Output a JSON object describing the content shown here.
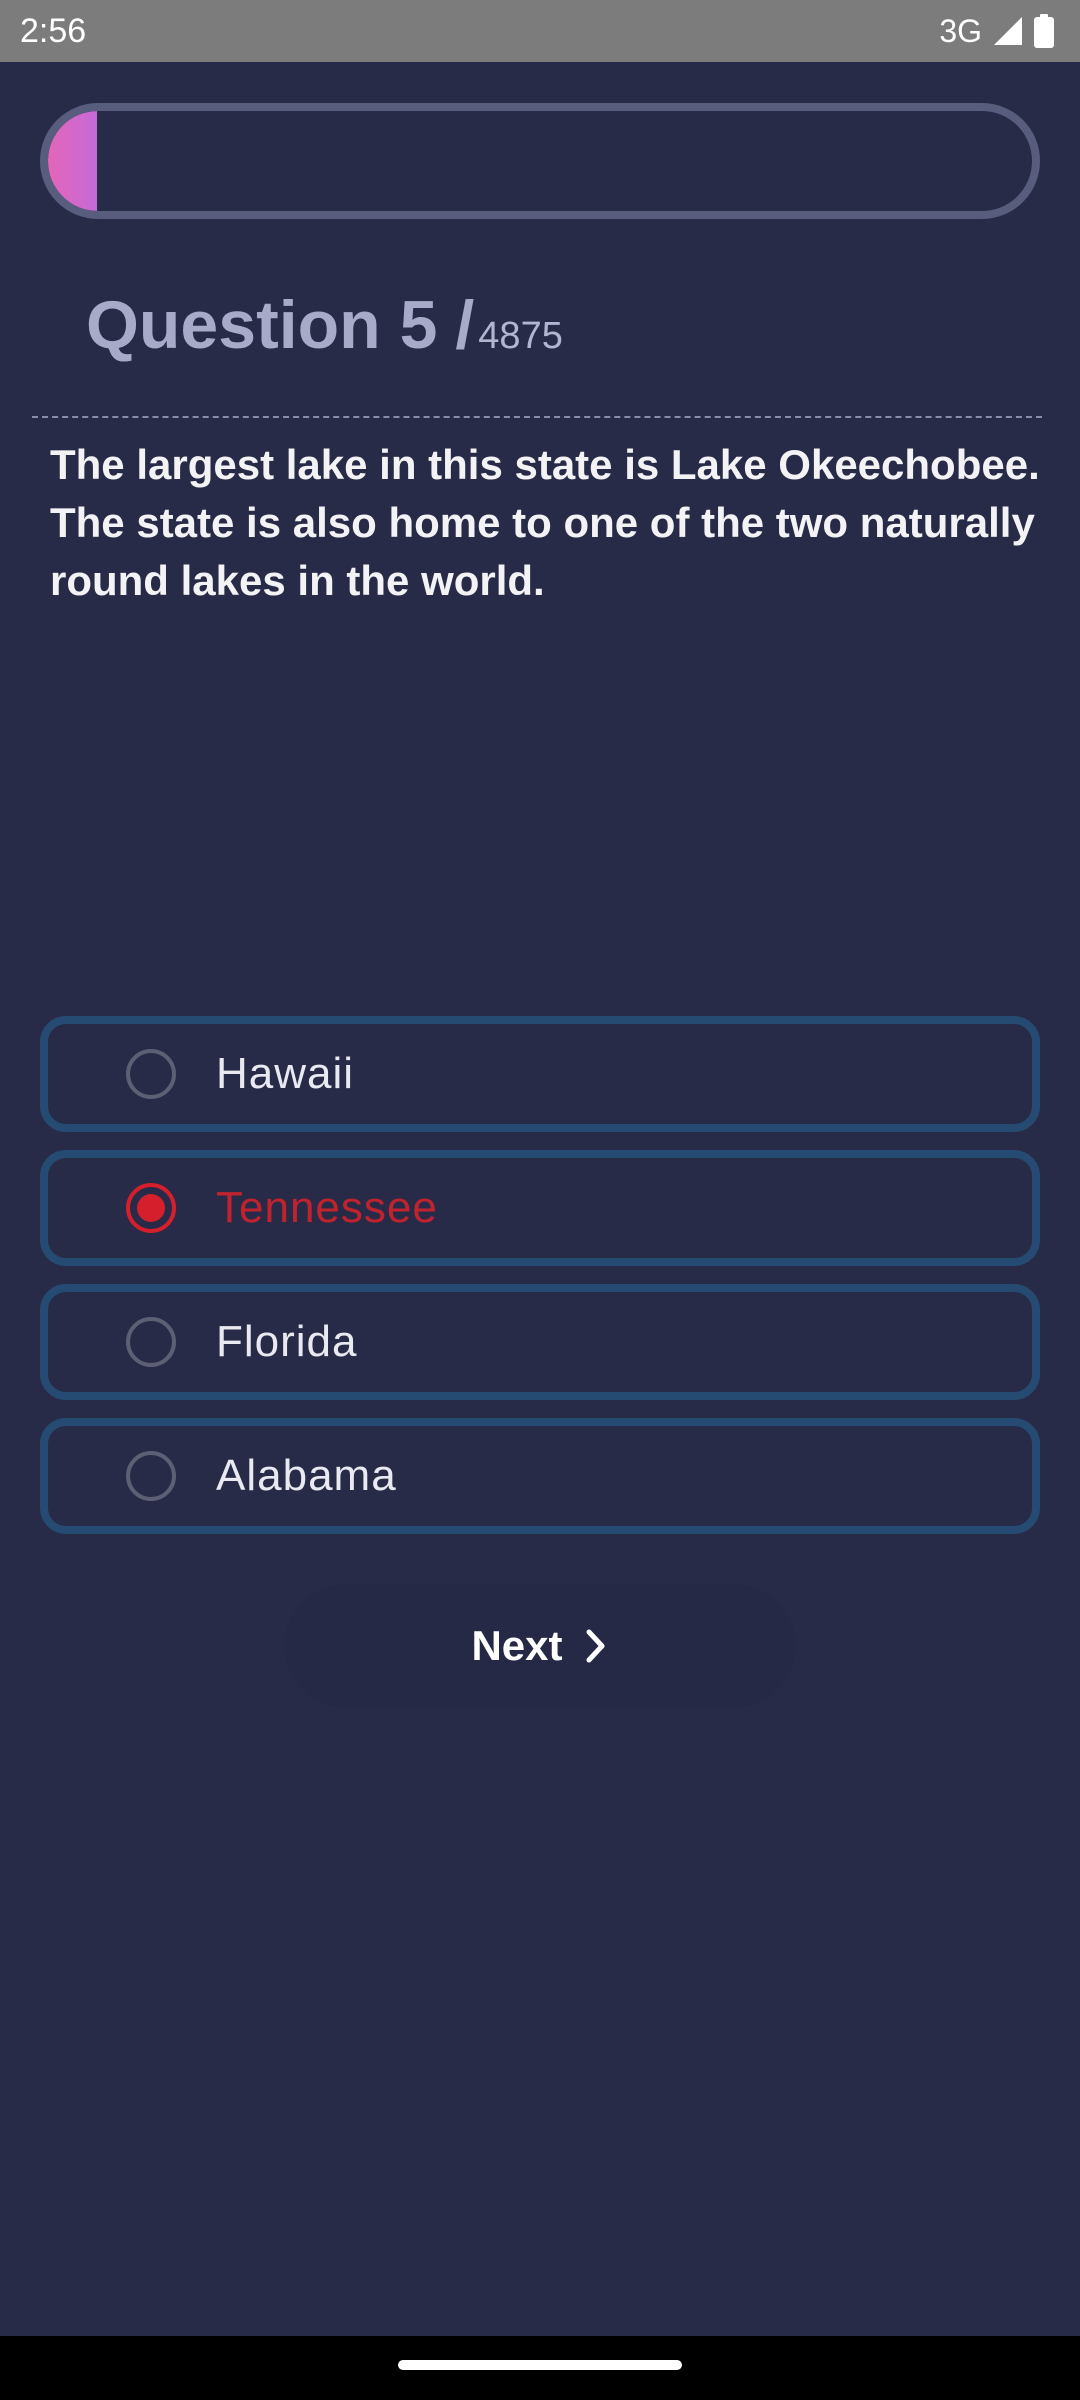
{
  "status_bar": {
    "time": "2:56",
    "network": "3G",
    "signal_icon": "signal-icon",
    "battery_icon": "battery-icon"
  },
  "progress": {
    "fraction": 0.05,
    "colors": [
      "#e466b8",
      "#c56ad8"
    ]
  },
  "question": {
    "label": "Question 5",
    "slash": "/",
    "total": "4875",
    "text": "The largest lake in this state is Lake Okeechobee. The state is also home to one of the two naturally round lakes in the world."
  },
  "options": [
    {
      "label": "Hawaii",
      "selected": false
    },
    {
      "label": "Tennessee",
      "selected": true
    },
    {
      "label": "Florida",
      "selected": false
    },
    {
      "label": "Alabama",
      "selected": false
    }
  ],
  "next_button": {
    "label": "Next",
    "icon": "chevron-right-icon"
  },
  "colors": {
    "background": "#282b47",
    "option_border": "#254b73",
    "selected": "#d61f2c"
  }
}
